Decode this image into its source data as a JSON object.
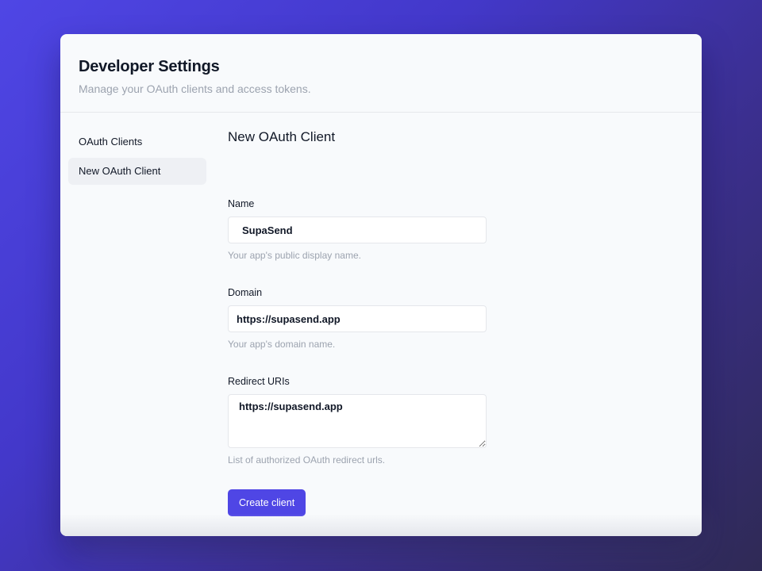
{
  "header": {
    "title": "Developer Settings",
    "subtitle": "Manage your OAuth clients and access tokens."
  },
  "sidebar": {
    "items": [
      {
        "label": "OAuth Clients",
        "active": false
      },
      {
        "label": "New OAuth Client",
        "active": true
      }
    ]
  },
  "form": {
    "title": "New OAuth Client",
    "name": {
      "label": "Name",
      "value": "SupaSend",
      "help": "Your app's public display name."
    },
    "domain": {
      "label": "Domain",
      "value": "https://supasend.app",
      "help": "Your app's domain name."
    },
    "redirect_uris": {
      "label": "Redirect URIs",
      "value": "https://supasend.app",
      "help": "List of authorized OAuth redirect urls."
    },
    "submit_label": "Create client"
  },
  "colors": {
    "accent": "#4f46e5",
    "card_background": "#f8fafc",
    "muted_text": "#9ca3af"
  }
}
